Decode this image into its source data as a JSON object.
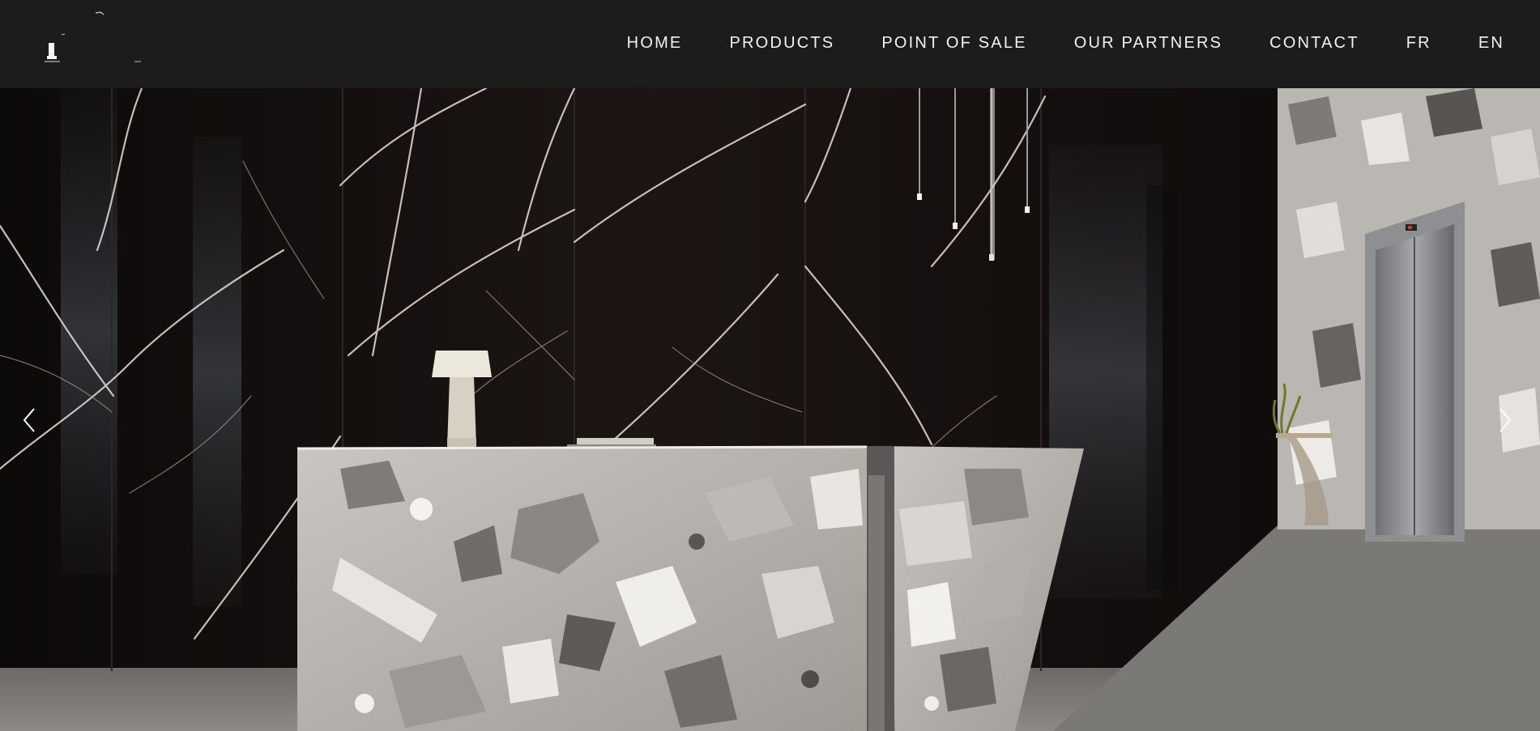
{
  "header": {
    "logo": {
      "icon": "lighthouse-logo-icon"
    },
    "nav": [
      {
        "label": "HOME"
      },
      {
        "label": "PRODUCTS"
      },
      {
        "label": "POINT OF SALE"
      },
      {
        "label": "OUR PARTNERS"
      },
      {
        "label": "CONTACT"
      },
      {
        "label": "FR"
      },
      {
        "label": "EN"
      }
    ]
  },
  "hero": {
    "slide_image": "marble-lobby-reception-image",
    "prev_icon": "chevron-left-icon",
    "next_icon": "chevron-right-icon"
  },
  "colors": {
    "header_bg": "#1c1c1c",
    "nav_text": "#f2f2f2",
    "marble_dark": "#1a1412",
    "terrazzo_light": "#b9b5b1"
  }
}
